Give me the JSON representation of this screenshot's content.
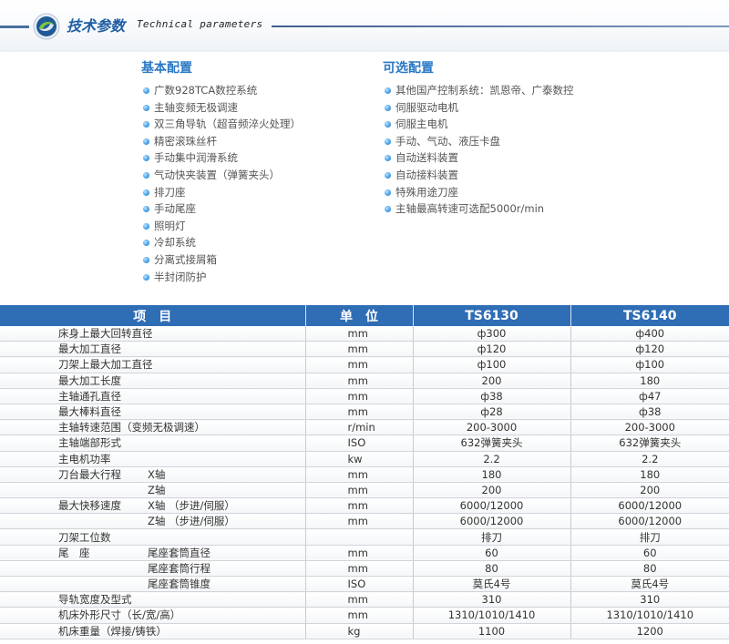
{
  "header": {
    "title_cn": "技术参数",
    "title_en": "Technical parameters"
  },
  "basic": {
    "title": "基本配置",
    "items": [
      "广数928TCA数控系统",
      "主轴变频无极调速",
      "双三角导轨（超音频淬火处理）",
      "精密滚珠丝杆",
      "手动集中润滑系统",
      "气动快夹装置（弹簧夹头）",
      "排刀座",
      "手动尾座",
      "照明灯",
      "冷却系统",
      "分离式接屑箱",
      "半封闭防护"
    ]
  },
  "optional": {
    "title": "可选配置",
    "items": [
      "其他国产控制系统：凯恩帝、广泰数控",
      "伺服驱动电机",
      "伺服主电机",
      "手动、气动、液压卡盘",
      "自动送料装置",
      "自动接料装置",
      "特殊用途刀座",
      "主轴最高转速可选配5000r/min"
    ]
  },
  "table": {
    "headers": [
      "项　目",
      "单　位",
      "TS6130",
      "TS6140"
    ],
    "rows": [
      {
        "a": "床身上最大回转直径",
        "b": "",
        "u": "mm",
        "v1": "ф300",
        "v2": "ф400"
      },
      {
        "a": "最大加工直径",
        "b": "",
        "u": "mm",
        "v1": "ф120",
        "v2": "ф120"
      },
      {
        "a": "刀架上最大加工直径",
        "b": "",
        "u": "mm",
        "v1": "ф100",
        "v2": "ф100"
      },
      {
        "a": "最大加工长度",
        "b": "",
        "u": "mm",
        "v1": "200",
        "v2": "180"
      },
      {
        "a": "主轴通孔直径",
        "b": "",
        "u": "mm",
        "v1": "ф38",
        "v2": "ф47"
      },
      {
        "a": "最大棒料直径",
        "b": "",
        "u": "mm",
        "v1": "ф28",
        "v2": "ф38"
      },
      {
        "a": "主轴转速范围（变频无极调速）",
        "b": "",
        "u": "r/min",
        "v1": "200-3000",
        "v2": "200-3000"
      },
      {
        "a": "主轴端部形式",
        "b": "",
        "u": "ISO",
        "v1": "632弹簧夹头",
        "v2": "632弹簧夹头"
      },
      {
        "a": "主电机功率",
        "b": "",
        "u": "kw",
        "v1": "2.2",
        "v2": "2.2"
      },
      {
        "a": "刀台最大行程",
        "b": "X轴",
        "u": "mm",
        "v1": "180",
        "v2": "180"
      },
      {
        "a": "",
        "b": "Z轴",
        "u": "mm",
        "v1": "200",
        "v2": "200"
      },
      {
        "a": "最大快移速度",
        "b": "X轴 （步进/伺服）",
        "u": "mm",
        "v1": "6000/12000",
        "v2": "6000/12000"
      },
      {
        "a": "",
        "b": "Z轴 （步进/伺服）",
        "u": "mm",
        "v1": "6000/12000",
        "v2": "6000/12000"
      },
      {
        "a": "刀架工位数",
        "b": "",
        "u": "",
        "v1": "排刀",
        "v2": "排刀"
      },
      {
        "a": "尾　座",
        "b": "尾座套筒直径",
        "u": "mm",
        "v1": "60",
        "v2": "60"
      },
      {
        "a": "",
        "b": "尾座套筒行程",
        "u": "mm",
        "v1": "80",
        "v2": "80"
      },
      {
        "a": "",
        "b": "尾座套筒锥度",
        "u": "ISO",
        "v1": "莫氏4号",
        "v2": "莫氏4号"
      },
      {
        "a": "导轨宽度及型式",
        "b": "",
        "u": "mm",
        "v1": "310",
        "v2": "310"
      },
      {
        "a": "机床外形尺寸（长/宽/高）",
        "b": "",
        "u": "mm",
        "v1": "1310/1010/1410",
        "v2": "1310/1010/1410"
      },
      {
        "a": "机床重量（焊接/铸铁）",
        "b": "",
        "u": "kg",
        "v1": "1100",
        "v2": "1200"
      }
    ]
  }
}
